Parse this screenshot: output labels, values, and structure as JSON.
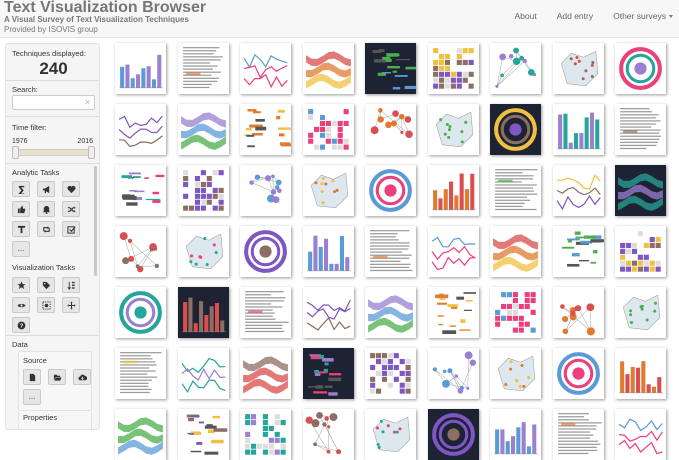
{
  "header": {
    "title": "Text Visualization Browser",
    "subtitle": "A Visual Survey of Text Visualization Techniques",
    "provided_by": "Provided by ISOVIS group",
    "nav": [
      {
        "label": "About"
      },
      {
        "label": "Add entry"
      },
      {
        "label": "Other surveys"
      }
    ]
  },
  "sidebar": {
    "techniques_label": "Techniques displayed:",
    "techniques_count": "240",
    "search_label": "Search:",
    "search_value": "",
    "search_clear": "✕",
    "time_label": "Time filter:",
    "time_start": "1976",
    "time_end": "2016",
    "analytic_label": "Analytic Tasks",
    "analytic_buttons": [
      "summarize-icon",
      "bullhorn-icon",
      "heart-icon",
      "thumbs-up-icon",
      "bell-icon",
      "shuffle-icon",
      "text-icon",
      "retweet-icon",
      "check-square-icon",
      "more-icon"
    ],
    "more_label": "...",
    "vis_label": "Visualization Tasks",
    "vis_buttons": [
      "star-icon",
      "tags-icon",
      "sort-icon",
      "eye-icon",
      "screenshot-icon",
      "move-icon",
      "question-icon"
    ],
    "data_label": "Data",
    "source_label": "Source",
    "source_buttons": [
      "file-icon",
      "folder-open-icon",
      "cloud-icon",
      "more-icon"
    ],
    "properties_label": "Properties"
  },
  "thumbnails": {
    "accent_colors": [
      "#9b7fd1",
      "#e07a2e",
      "#5b9bd5",
      "#d94e4e",
      "#4cae4c",
      "#f0c040",
      "#26a69a",
      "#8d6e63",
      "#ec407a",
      "#7e57c2"
    ],
    "count": 63
  }
}
